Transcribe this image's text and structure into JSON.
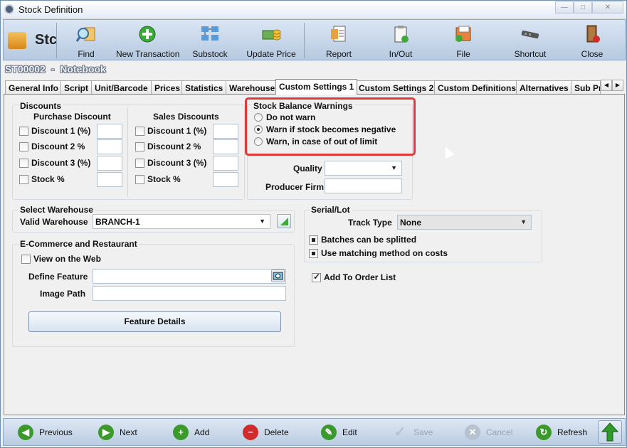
{
  "window": {
    "title": "Stock Definition",
    "minimize": "—",
    "maximize": "□",
    "close": "✕"
  },
  "logo": {
    "text": "Stc"
  },
  "toolbar": [
    {
      "label": "Find",
      "icon": "find-icon"
    },
    {
      "label": "New Transaction",
      "icon": "add-circle-icon"
    },
    {
      "label": "Substock",
      "icon": "substock-icon"
    },
    {
      "label": "Update Price",
      "icon": "money-icon"
    },
    {
      "label": "Report",
      "icon": "report-icon"
    },
    {
      "label": "In/Out",
      "icon": "clipboard-icon"
    },
    {
      "label": "File",
      "icon": "file-icon"
    },
    {
      "label": "Shortcut",
      "icon": "shortcut-icon"
    },
    {
      "label": "Close",
      "icon": "door-icon"
    }
  ],
  "record": {
    "code": "ST00002",
    "separator": "-",
    "name": "Notebook"
  },
  "tabs": [
    "General Info",
    "Script",
    "Unit/Barcode",
    "Prices",
    "Statistics",
    "Warehouse",
    "Custom Settings 1",
    "Custom Settings 2",
    "Custom Definitions",
    "Alternatives",
    "Sub Pr"
  ],
  "active_tab": "Custom Settings 1",
  "discounts": {
    "title": "Discounts",
    "purchase_title": "Purchase Discount",
    "sales_title": "Sales Discounts",
    "purchase": [
      "Discount 1 (%)",
      "Discount 2 %",
      "Discount 3 (%)",
      "Stock %"
    ],
    "sales": [
      "Discount 1 (%)",
      "Discount 2 %",
      "Discount 3 (%)",
      "Stock %"
    ]
  },
  "stock_warnings": {
    "title": "Stock Balance Warnings",
    "options": [
      "Do not warn",
      "Warn if stock becomes negative",
      "Warn, in case of out of limit"
    ],
    "selected_index": 1
  },
  "quality": {
    "label": "Quality",
    "value": ""
  },
  "producer": {
    "label": "Producer Firm",
    "value": ""
  },
  "warehouse": {
    "title": "Select Warehouse",
    "label": "Valid Warehouse",
    "value": "BRANCH-1"
  },
  "serial": {
    "title": "Serial/Lot",
    "track_label": "Track Type",
    "track_value": "None",
    "batches": "Batches can be splitted",
    "matching": "Use matching method on costs"
  },
  "ecommerce": {
    "title": "E-Commerce and Restaurant",
    "web": "View on the Web",
    "feature_label": "Define Feature",
    "feature_value": "",
    "image_label": "Image Path",
    "image_value": "",
    "button": "Feature Details"
  },
  "order": {
    "label": "Add To Order List",
    "checked": true
  },
  "bottom": [
    {
      "label": "Previous",
      "icon": "arrow-left-icon",
      "enabled": true,
      "color": "#3c9a2c"
    },
    {
      "label": "Next",
      "icon": "arrow-right-icon",
      "enabled": true,
      "color": "#3c9a2c"
    },
    {
      "label": "Add",
      "icon": "plus-icon",
      "enabled": true,
      "color": "#3c9a2c"
    },
    {
      "label": "Delete",
      "icon": "minus-icon",
      "enabled": true,
      "color": "#d22b2b"
    },
    {
      "label": "Edit",
      "icon": "edit-icon",
      "enabled": true,
      "color": "#3c9a2c"
    },
    {
      "label": "Save",
      "icon": "check-icon",
      "enabled": false,
      "color": "#b7c2cf"
    },
    {
      "label": "Cancel",
      "icon": "cancel-icon",
      "enabled": false,
      "color": "#b7c2cf"
    },
    {
      "label": "Refresh",
      "icon": "refresh-icon",
      "enabled": true,
      "color": "#3c9a2c"
    }
  ]
}
